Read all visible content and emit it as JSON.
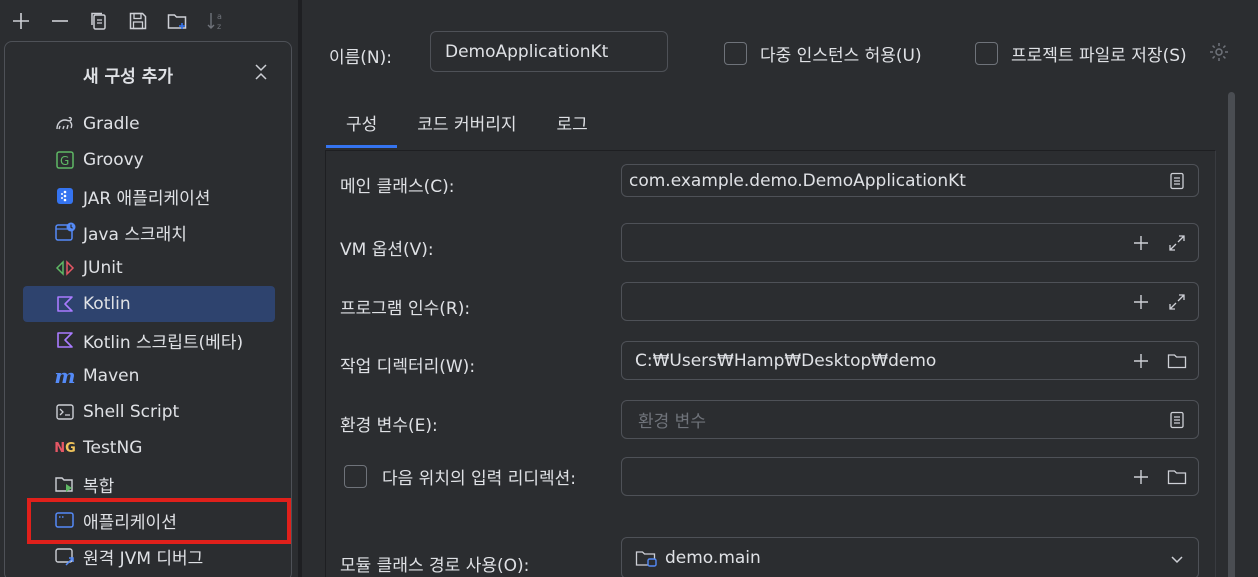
{
  "toolbar": {
    "icons": [
      "plus-icon",
      "minus-icon",
      "copy-icon",
      "save-icon",
      "new-folder-icon",
      "sort-icon"
    ]
  },
  "popup": {
    "title": "새 구성 추가",
    "items": [
      {
        "label": "Gradle",
        "icon": "gradle-icon"
      },
      {
        "label": "Groovy",
        "icon": "groovy-icon"
      },
      {
        "label": "JAR 애플리케이션",
        "icon": "jar-icon"
      },
      {
        "label": "Java 스크래치",
        "icon": "java-scratch-icon"
      },
      {
        "label": "JUnit",
        "icon": "junit-icon"
      },
      {
        "label": "Kotlin",
        "icon": "kotlin-icon"
      },
      {
        "label": "Kotlin 스크립트(베타)",
        "icon": "kotlin-script-icon"
      },
      {
        "label": "Maven",
        "icon": "maven-icon"
      },
      {
        "label": "Shell Script",
        "icon": "shell-icon"
      },
      {
        "label": "TestNG",
        "icon": "testng-icon"
      },
      {
        "label": "복합",
        "icon": "compound-icon"
      },
      {
        "label": "애플리케이션",
        "icon": "application-icon"
      },
      {
        "label": "원격 JVM 디버그",
        "icon": "remote-debug-icon"
      }
    ],
    "selected": "Kotlin"
  },
  "header": {
    "name_label": "이름(N):",
    "name_value": "DemoApplicationKt",
    "allow_multiple": "다중 인스턴스 허용(U)",
    "store_as_file": "프로젝트 파일로 저장(S)"
  },
  "tabs": [
    {
      "label": "구성",
      "active": true
    },
    {
      "label": "코드 커버리지",
      "active": false
    },
    {
      "label": "로그",
      "active": false
    }
  ],
  "form": {
    "main_class_label": "메인 클래스(C):",
    "main_class_value": "com.example.demo.DemoApplicationKt",
    "vm_options_label": "VM 옵션(V):",
    "vm_options_value": "",
    "program_args_label": "프로그램 인수(R):",
    "program_args_value": "",
    "working_dir_label": "작업 디렉터리(W):",
    "working_dir_value": "C:₩Users₩Hamp₩Desktop₩demo",
    "env_vars_label": "환경 변수(E):",
    "env_vars_placeholder": "환경 변수",
    "redirect_label": "다음 위치의 입력 리디렉션:",
    "redirect_value": "",
    "module_classpath_label": "모듈 클래스 경로 사용(O):",
    "module_classpath_value": "demo.main"
  },
  "colors": {
    "accent": "#3574f0",
    "selection": "#2e436e",
    "highlight_box": "#e0201b",
    "background": "#2b2d30"
  }
}
